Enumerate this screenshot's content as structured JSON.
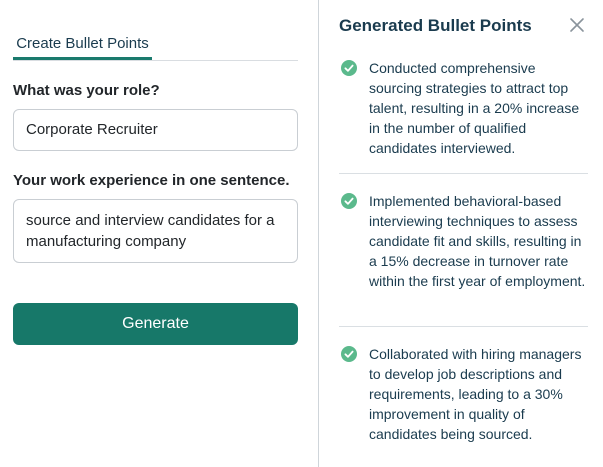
{
  "form": {
    "tab_label": "Create Bullet Points",
    "role_label": "What was your role?",
    "role_value": "Corporate Recruiter",
    "experience_label": "Your work experience in one sentence.",
    "experience_value": "source and interview candidates for a manufacturing company",
    "generate_label": "Generate"
  },
  "results": {
    "title": "Generated Bullet Points",
    "close_icon": "close-icon",
    "check_icon": "check-circle-icon",
    "accent_color": "#177869",
    "check_color": "#5bb98c",
    "bullets": [
      "Conducted comprehensive sourcing strategies to attract top talent, resulting in a 20% increase in the number of qualified candidates interviewed.",
      "Implemented behavioral-based interviewing techniques to assess candidate fit and skills, resulting in a 15% decrease in turnover rate within the first year of employment.",
      "Collaborated with hiring managers to develop job descriptions and requirements, leading to a 30% improvement in quality of candidates being sourced."
    ]
  }
}
